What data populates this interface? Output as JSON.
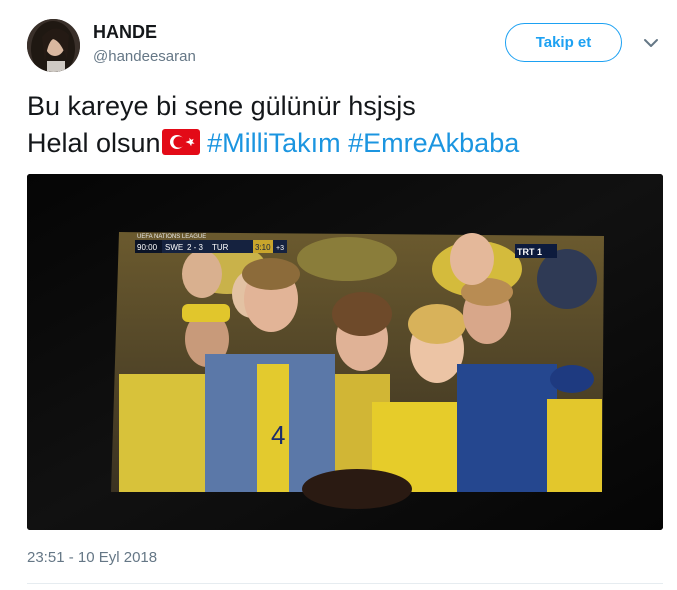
{
  "user": {
    "name": "HANDE",
    "handle": "@handeesaran"
  },
  "actions": {
    "follow_label": "Takip et"
  },
  "tweet": {
    "line1": "Bu kareye bi sene gülünür hsjsjs",
    "line2_text": "Helal olsun",
    "hashtag1": "#MilliTakım",
    "hashtag2": "#EmreAkbaba"
  },
  "media": {
    "broadcast_banner": "UEFA NATIONS LEAGUE",
    "match_time": "90:00",
    "home_team": "SWE",
    "score": "2 - 3",
    "away_team": "TUR",
    "added_time": "3:10",
    "extra_minutes": "+3",
    "channel": "TRT 1"
  },
  "timestamp": "23:51 - 10 Eyl 2018",
  "colors": {
    "accent": "#1da1f2",
    "hashtag": "#1b95e0",
    "secondary_text": "#657786",
    "flag_red": "#e30a17"
  }
}
